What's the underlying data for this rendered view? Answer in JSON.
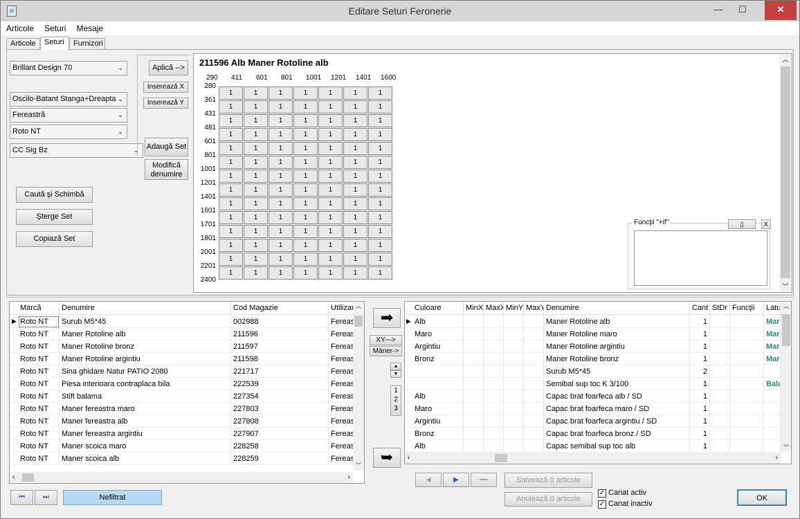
{
  "window": {
    "title": "Editare Seturi Feronerie",
    "icon": "app-icon",
    "controls": {
      "minimize": "—",
      "maximize": "☐",
      "close": "✕"
    }
  },
  "menu": [
    "Articole",
    "Seturi",
    "Mesaje"
  ],
  "tabs": [
    "Articole",
    "Seturi",
    "Furnizori"
  ],
  "active_tab": "Seturi",
  "left": {
    "combo_profile": "Brillant Design 70",
    "combo_type": "Oscilo-Batant Stanga+Dreapta",
    "combo_kind": "Fereastră",
    "combo_brand": "Roto NT",
    "combo_set": "CC Sig Bz",
    "btn_apply": "Aplică  -->",
    "btn_insert_x": "Inserează X",
    "btn_insert_y": "Inserează Y",
    "btn_add_set": "Adaugă Set",
    "btn_modify_1": "Modifică",
    "btn_modify_2": "denumire",
    "btn_search": "Caută şi Schimbă",
    "btn_delete": "Şterge Set",
    "btn_copy": "Copiază Set"
  },
  "grid": {
    "title": "211596  Alb  Maner Rotoline alb",
    "cols": [
      "290",
      "411",
      "601",
      "801",
      "1001",
      "1201",
      "1401",
      "1600"
    ],
    "rows": [
      "280",
      "361",
      "431",
      "481",
      "601",
      "801",
      "1001",
      "1201",
      "1401",
      "1601",
      "1701",
      "1801",
      "2001",
      "2201",
      "2400"
    ],
    "cell_value": "1",
    "functions_label": "Funcţii \"+if\"",
    "functions_btn": "▯",
    "functions_close": "X"
  },
  "left_table": {
    "headers": [
      "Marcă",
      "Denumire",
      "Cod Magazie",
      "Utilizar"
    ],
    "rows": [
      [
        "Roto NT",
        "Surub M5*45",
        "002988",
        "Fereas"
      ],
      [
        "Roto NT",
        "Maner Rotoline alb",
        "211596",
        "Fereas"
      ],
      [
        "Roto NT",
        "Maner Rotoline bronz",
        "211597",
        "Fereas"
      ],
      [
        "Roto NT",
        "Maner Rotoline argintiu",
        "211598",
        "Fereas"
      ],
      [
        "Roto NT",
        "Sina ghidare Natur PATIO 2080",
        "221717",
        "Fereas"
      ],
      [
        "Roto NT",
        "Piesa interioara contraplaca bila",
        "222539",
        "Fereas"
      ],
      [
        "Roto NT",
        "Stift balama",
        "227354",
        "Fereas"
      ],
      [
        "Roto NT",
        "Maner fereastra maro",
        "227803",
        "Fereas"
      ],
      [
        "Roto NT",
        "Maner fereastra alb",
        "227808",
        "Fereas"
      ],
      [
        "Roto NT",
        "Maner fereastra argintiu",
        "227907",
        "Fereas"
      ],
      [
        "Roto NT",
        "Maner scoica maro",
        "228258",
        "Fereas"
      ],
      [
        "Roto NT",
        "Maner scoica alb",
        "228259",
        "Fereas"
      ]
    ]
  },
  "middle": {
    "xy": "XY--->",
    "maner": "Mâner->",
    "order": [
      "1",
      "2",
      "3"
    ],
    "arrow_right": "➡",
    "arrow_bottom": "➥"
  },
  "right_table": {
    "headers": [
      "Culoare",
      "MinX",
      "MaxX",
      "MinY",
      "MaxY",
      "Denumire",
      "Cant",
      "StDr",
      "Funcţii",
      "Latu"
    ],
    "rows": [
      [
        "Alb",
        "",
        "",
        "",
        "",
        "Maner Rotoline alb",
        "1",
        "",
        "",
        "Mar"
      ],
      [
        "Maro",
        "",
        "",
        "",
        "",
        "Maner Rotoline maro",
        "1",
        "",
        "",
        "Mar"
      ],
      [
        "Argintiu",
        "",
        "",
        "",
        "",
        "Maner Rotoline argintiu",
        "1",
        "",
        "",
        "Mar"
      ],
      [
        "Bronz",
        "",
        "",
        "",
        "",
        "Maner Rotoline bronz",
        "1",
        "",
        "",
        "Mar"
      ],
      [
        "",
        "",
        "",
        "",
        "",
        "Surub M5*45",
        "2",
        "",
        "",
        ""
      ],
      [
        "",
        "",
        "",
        "",
        "",
        "Semibal sup toc K 3/100",
        "1",
        "",
        "",
        "Bala"
      ],
      [
        "Alb",
        "",
        "",
        "",
        "",
        "Capac brat foarfeca alb / SD",
        "1",
        "",
        "",
        ""
      ],
      [
        "Maro",
        "",
        "",
        "",
        "",
        "Capac brat foarfeca maro / SD",
        "1",
        "",
        "",
        ""
      ],
      [
        "Argintiu",
        "",
        "",
        "",
        "",
        "Capac brat foarfeca argintiu / SD",
        "1",
        "",
        "",
        ""
      ],
      [
        "Bronz",
        "",
        "",
        "",
        "",
        "Capac brat foarfeca bronz / SD",
        "1",
        "",
        "",
        ""
      ],
      [
        "Alb",
        "",
        "",
        "",
        "",
        "Capac semibal sup toc alb",
        "1",
        "",
        "",
        ""
      ]
    ]
  },
  "bottom": {
    "nefiltrat": "Nefiltrat",
    "save": "Salvează 0 articole",
    "cancel": "Anulează 0 articole",
    "canat_activ": "Canat activ",
    "canat_inactiv": "Canat inactiv",
    "ok": "OK",
    "nav_prev": "◀",
    "nav_next": "▶",
    "nav_minus": "—",
    "first": "⏮",
    "last": "⏭"
  },
  "colors": {
    "accent": "#2a8a80",
    "nefiltrat_bg": "#b8d7f0",
    "close_red": "#c74040"
  }
}
